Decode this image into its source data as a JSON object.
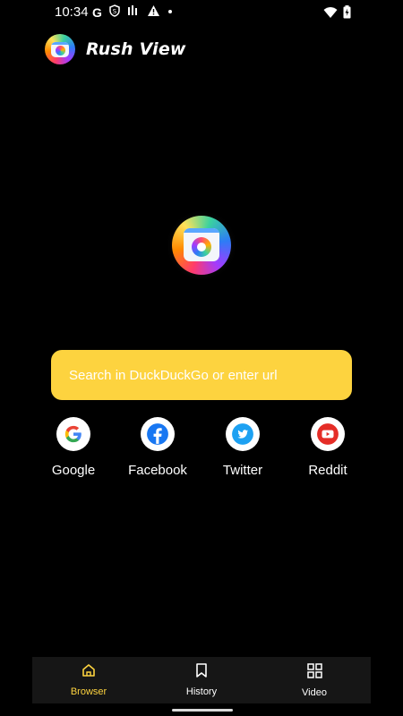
{
  "status_bar": {
    "time": "10:34",
    "left_icons": [
      "google-g-icon",
      "shield-s-icon",
      "signal-bars-icon",
      "warning-icon",
      "dot-icon"
    ],
    "right_icons": [
      "wifi-icon",
      "battery-charging-icon"
    ]
  },
  "header": {
    "app_name": "Rush View"
  },
  "search": {
    "placeholder": "Search in DuckDuckGo or enter url",
    "value": ""
  },
  "shortcuts": [
    {
      "label": "Google",
      "icon": "google-icon"
    },
    {
      "label": "Facebook",
      "icon": "facebook-icon"
    },
    {
      "label": "Twitter",
      "icon": "twitter-icon"
    },
    {
      "label": "Reddit",
      "icon": "youtube-icon"
    }
  ],
  "bottom_nav": {
    "items": [
      {
        "label": "Browser",
        "icon": "home-icon",
        "active": true
      },
      {
        "label": "History",
        "icon": "bookmark-icon",
        "active": false
      },
      {
        "label": "Video",
        "icon": "grid-icon",
        "active": false
      }
    ]
  },
  "colors": {
    "accent": "#fdd33f",
    "background": "#000000",
    "nav_background": "#161616"
  }
}
